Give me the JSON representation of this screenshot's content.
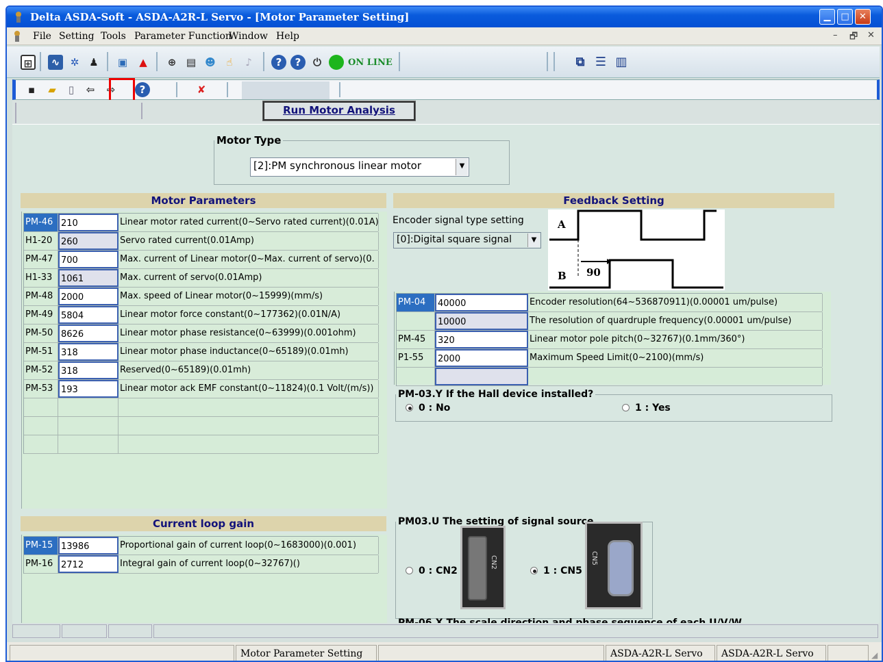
{
  "window": {
    "title": "Delta ASDA-Soft - ASDA-A2R-L Servo - [Motor Parameter Setting]"
  },
  "menu": [
    "File",
    "Setting",
    "Tools",
    "Parameter Function",
    "Window",
    "Help"
  ],
  "toolbar": {
    "online_label": "ON LINE"
  },
  "actions": {
    "run_motor_analysis": "Run Motor Analysis"
  },
  "motor_type": {
    "legend": "Motor Type",
    "selected": "[2]:PM synchronous linear motor"
  },
  "motor_parameters": {
    "title": "Motor Parameters",
    "rows": [
      {
        "id": "PM-46",
        "value": "210",
        "desc": "Linear motor rated current(0~Servo rated current)(0.01A)"
      },
      {
        "id": "H1-20",
        "value": "260",
        "desc": "Servo rated current(0.01Amp)"
      },
      {
        "id": "PM-47",
        "value": "700",
        "desc": "Max. current of Linear motor(0~Max. current of servo)(0."
      },
      {
        "id": "H1-33",
        "value": "1061",
        "desc": "Max. current of servo(0.01Amp)"
      },
      {
        "id": "PM-48",
        "value": "2000",
        "desc": "Max. speed of Linear motor(0~15999)(mm/s)"
      },
      {
        "id": "PM-49",
        "value": "5804",
        "desc": "Linear motor force constant(0~177362)(0.01N/A)"
      },
      {
        "id": "PM-50",
        "value": "8626",
        "desc": "Linear motor phase resistance(0~63999)(0.001ohm)"
      },
      {
        "id": "PM-51",
        "value": "318",
        "desc": "Linear motor phase inductance(0~65189)(0.01mh)"
      },
      {
        "id": "PM-52",
        "value": "318",
        "desc": "Reserved(0~65189)(0.01mh)"
      },
      {
        "id": "PM-53",
        "value": "193",
        "desc": "Linear motor ack EMF constant(0~11824)(0.1 Volt/(m/s))"
      }
    ]
  },
  "feedback": {
    "title": "Feedback Setting",
    "encoder_label": "Encoder signal type setting",
    "encoder_selected": "[0]:Digital square signal",
    "diagram": {
      "a": "A",
      "b": "B",
      "phase": "90"
    },
    "rows": [
      {
        "id": "PM-04",
        "value": "40000",
        "desc": "Encoder resolution(64~536870911)(0.00001 um/pulse)"
      },
      {
        "id": "",
        "value": "10000",
        "desc": "The resolution of quardruple frequency(0.00001 um/pulse)"
      },
      {
        "id": "PM-45",
        "value": "320",
        "desc": "Linear motor pole pitch(0~32767)(0.1mm/360°)"
      },
      {
        "id": "P1-55",
        "value": "2000",
        "desc": "Maximum Speed Limit(0~2100)(mm/s)"
      }
    ]
  },
  "hall": {
    "legend": "PM-03.Y If the Hall device installed?",
    "opt0": "0 : No",
    "opt1": "1 : Yes"
  },
  "current_loop": {
    "title": "Current loop gain",
    "rows": [
      {
        "id": "PM-15",
        "value": "13986",
        "desc": "Proportional gain of current loop(0~1683000)(0.001)"
      },
      {
        "id": "PM-16",
        "value": "2712",
        "desc": "Integral gain of current loop(0~32767)()"
      }
    ]
  },
  "signal_source": {
    "legend": "PM03.U The setting of signal source",
    "opt0": "0 : CN2",
    "opt1": "1 : CN5",
    "cn2": "CN2",
    "cn5": "CN5"
  },
  "scale_dir": {
    "legend": "PM-06.X The scale direction and phase sequence of each U/V/W"
  },
  "status": {
    "p1": "Motor Parameter Setting",
    "p2": "ASDA-A2R-L Servo",
    "p3": "ASDA-A2R-L Servo"
  }
}
